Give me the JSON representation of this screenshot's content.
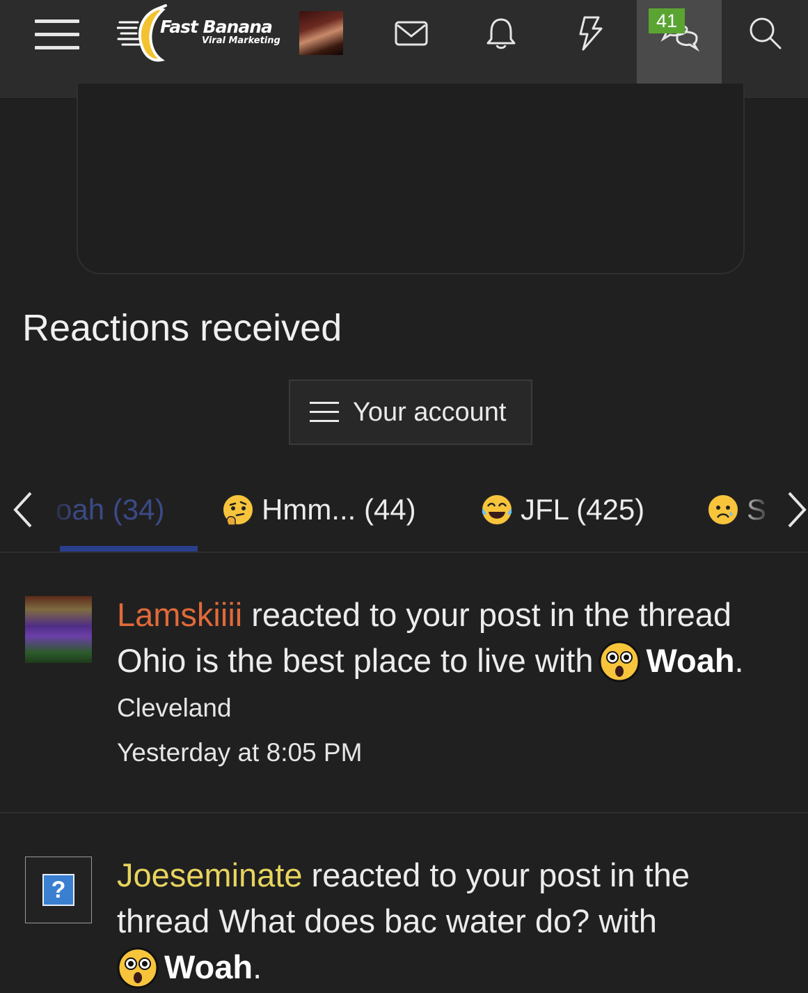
{
  "navbar": {
    "logo_title": "Fast Banana",
    "logo_subtitle": "Viral Marketing",
    "conversations_badge": "41",
    "icons": [
      "menu-icon",
      "logo",
      "avatar",
      "envelope-icon",
      "bell-icon",
      "lightning-icon",
      "chat-bubbles-icon",
      "search-icon"
    ]
  },
  "page": {
    "title": "Reactions received",
    "account_button": "Your account"
  },
  "tabs": [
    {
      "label": "oah (34)",
      "emoji": "surprised-face",
      "active": true
    },
    {
      "label": "Hmm... (44)",
      "emoji": "thinking-face",
      "active": false
    },
    {
      "label": "JFL (425)",
      "emoji": "tears-of-joy-face",
      "active": false
    },
    {
      "label": "S",
      "emoji": "sad-face",
      "active": false
    }
  ],
  "alerts": [
    {
      "username": "Lamskiiii",
      "text_before": " reacted to your post in the thread Ohio is the best place to live with",
      "reaction": "Woah",
      "location": "Cleveland",
      "time": "Yesterday at 8:05 PM"
    },
    {
      "username": "Joeseminate",
      "text_before": " reacted to your post in the thread What does bac water do? with",
      "reaction": "Woah",
      "avatar_placeholder": "?"
    }
  ],
  "colors": {
    "background": "#202020",
    "navbar": "#2c2c2c",
    "badge": "#5aa532",
    "active_tab": "#2a3f8c",
    "username_1": "#e06a3a",
    "username_2": "#e7d45e"
  }
}
